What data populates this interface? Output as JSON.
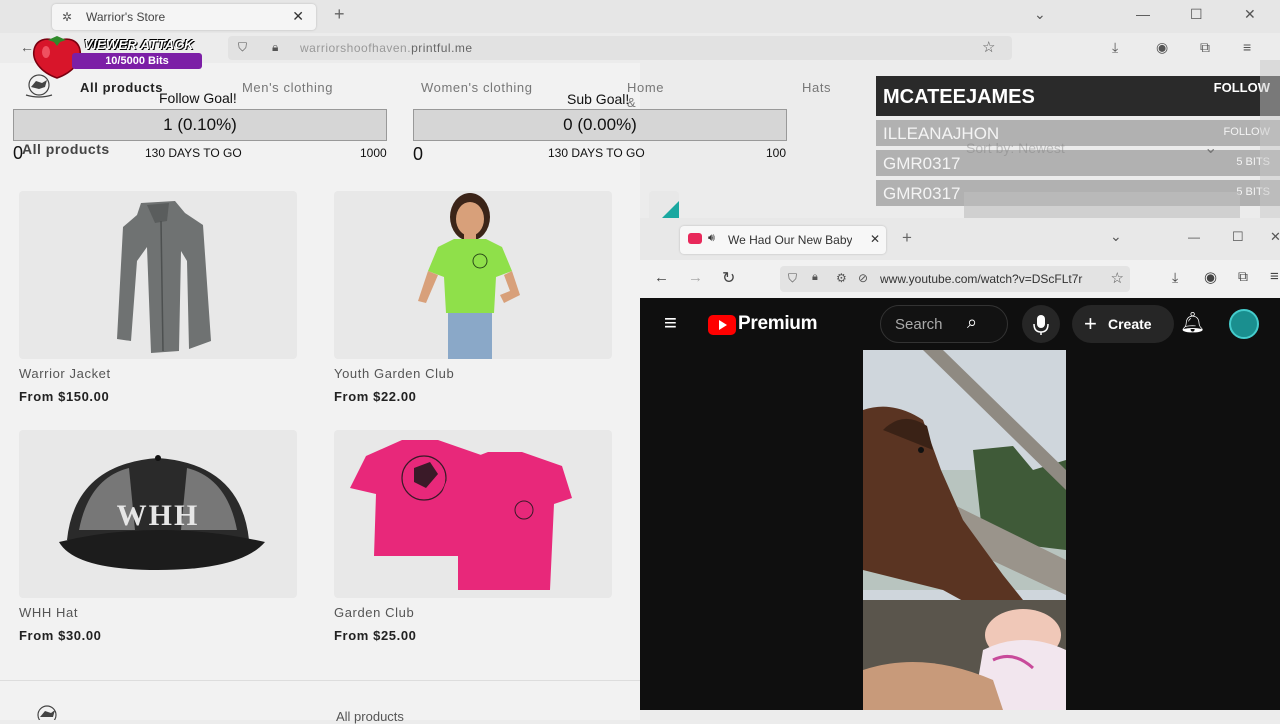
{
  "store_browser": {
    "tab_title": "Warrior's Store",
    "url_prefix": "warriorshoofhaven.",
    "url_domain": "printful.me"
  },
  "store": {
    "menu": [
      {
        "label": "All products"
      },
      {
        "label": "Men's clothing"
      },
      {
        "label": "Women's clothing"
      },
      {
        "label": "Home & living"
      },
      {
        "label": "Hats"
      }
    ],
    "heading": "All products",
    "sort_label": "Sort by: Newest",
    "products": [
      {
        "name": "Warrior Jacket",
        "price": "From $150.00"
      },
      {
        "name": "Youth Garden Club",
        "price": "From $22.00"
      },
      {
        "name": "WHH Hat",
        "price": "From $30.00"
      },
      {
        "name": "Garden Club",
        "price": "From $25.00"
      }
    ],
    "hat_text": "WHH",
    "footer_link": "All products"
  },
  "goals": {
    "follow": {
      "title": "Follow Goal!",
      "value": "1 (0.10%)",
      "min": "0",
      "max": "1000",
      "days": "130 DAYS TO GO",
      "progress": 0.001
    },
    "sub": {
      "title": "Sub Goal!",
      "value": "0 (0.00%)",
      "min": "0",
      "max": "100",
      "days": "130 DAYS TO GO",
      "progress": 0
    }
  },
  "viewer_attack": {
    "title": "VIEWER ATTACK",
    "progress_text": "10/5000 Bits",
    "progress": 0.002
  },
  "activity_feed": [
    {
      "name": "MCATEEJAMES",
      "tag": "FOLLOW"
    },
    {
      "name": "ILLEANAJHON",
      "tag": "FOLLOW"
    },
    {
      "name": "GMR0317",
      "tag": "5 BITS"
    },
    {
      "name": "GMR0317",
      "tag": "5 BITS"
    }
  ],
  "yt_browser": {
    "tab_title": "We Had Our New Baby! - Yo",
    "url": "www.youtube.com/watch?v=DScFLt7r",
    "brand": "Premium",
    "search_placeholder": "Search",
    "create_label": "Create"
  },
  "colors": {
    "youtube_red": "#ff0000",
    "badge_purple": "#7c1fa6",
    "shirt_green": "#8fe04a",
    "shirt_pink": "#e8287a"
  }
}
